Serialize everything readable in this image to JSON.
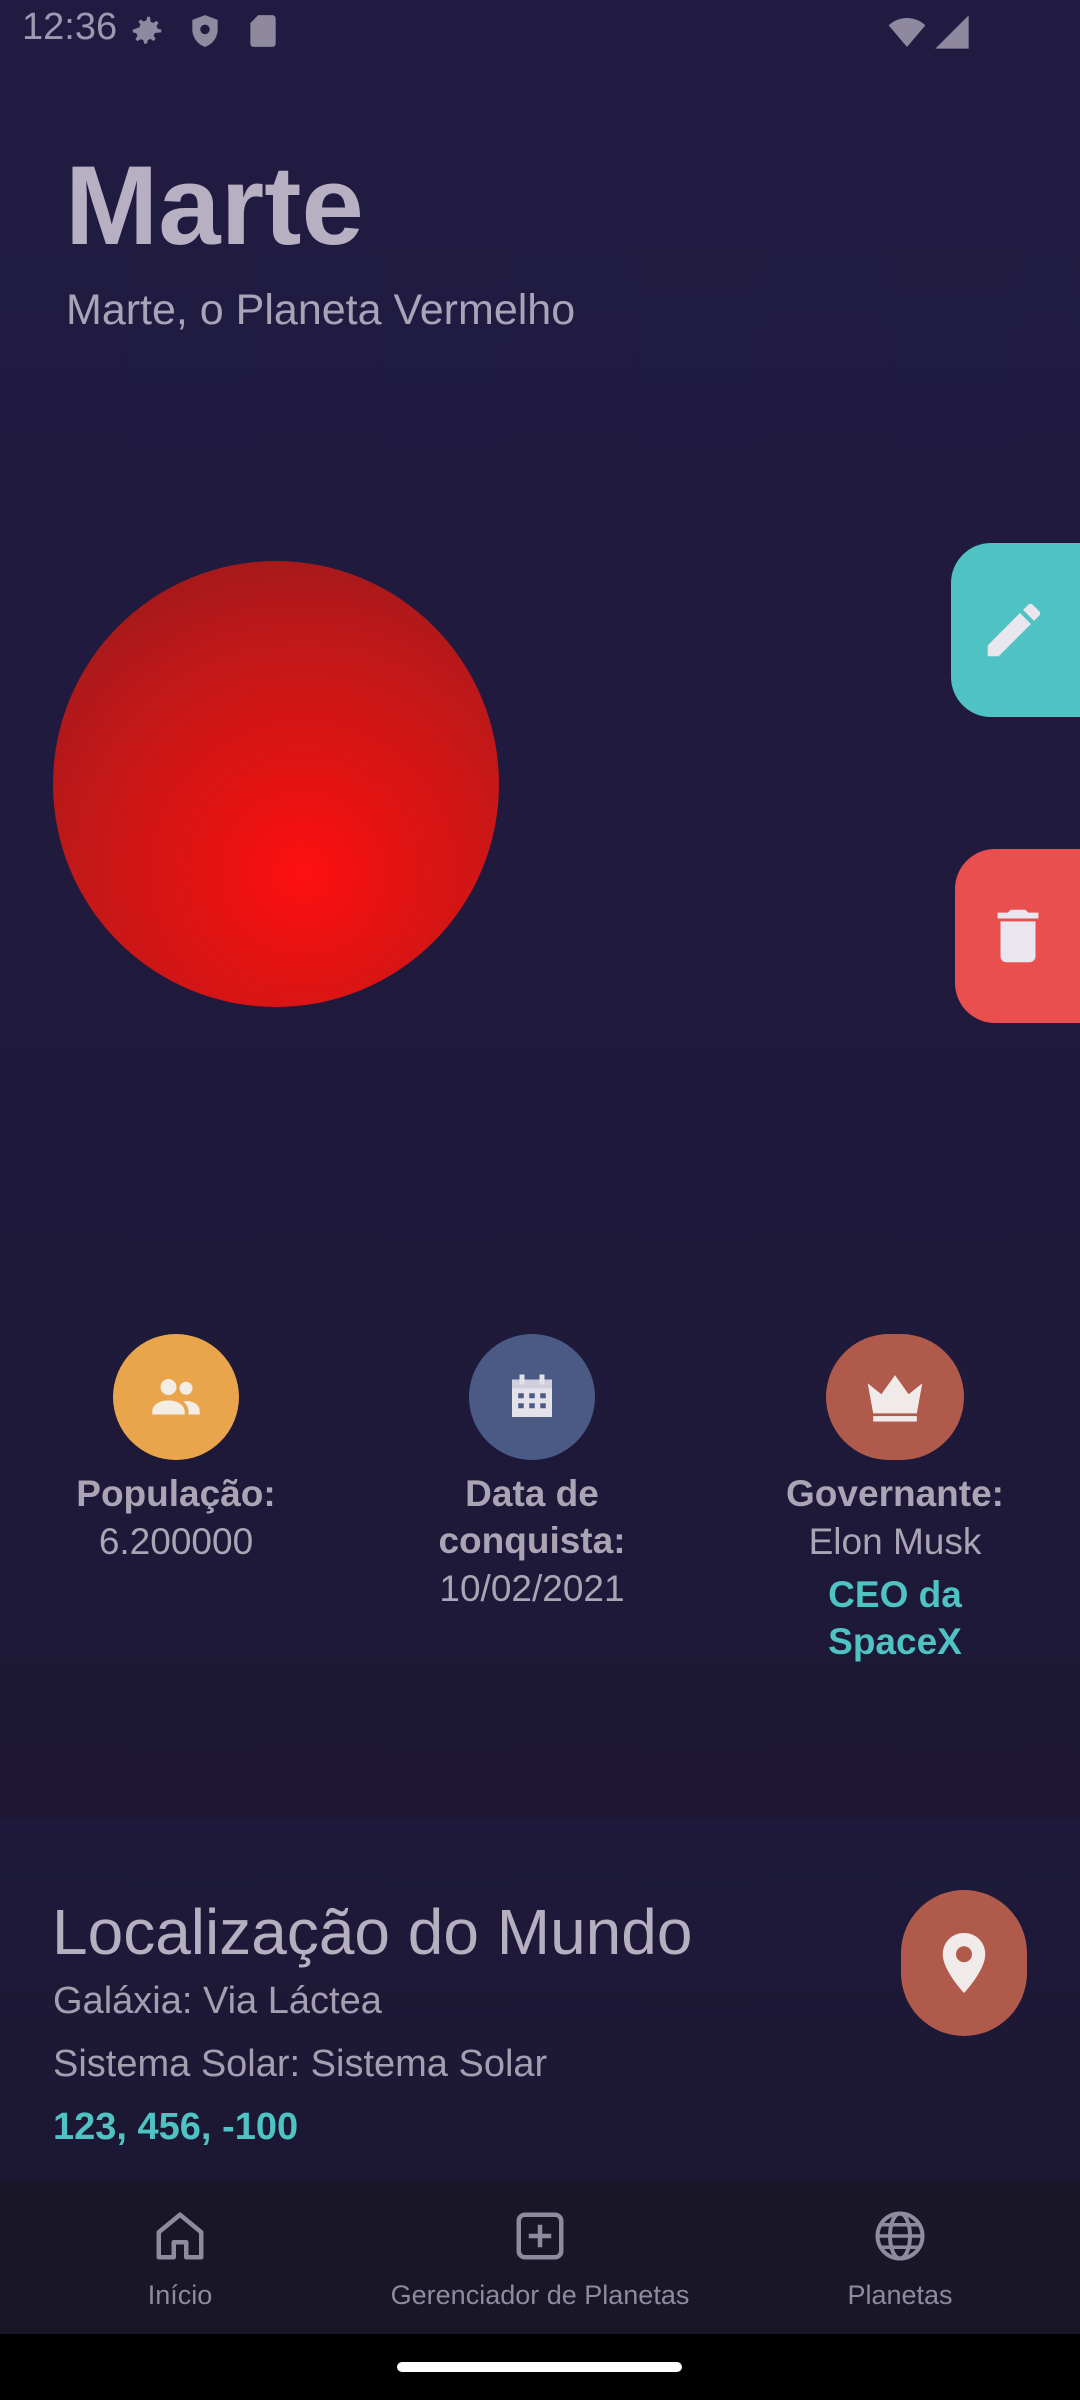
{
  "status_bar": {
    "time": "12:36",
    "left_icons": [
      "gear-icon",
      "shield-icon",
      "sd-card-icon"
    ],
    "right_icons": [
      "wifi-icon",
      "signal-icon"
    ]
  },
  "planet": {
    "name": "Marte",
    "description": "Marte, o Planeta Vermelho",
    "color": "#e51212"
  },
  "actions": {
    "edit_icon": "pencil-icon",
    "edit_color": "#4fc3c3",
    "delete_icon": "trash-icon",
    "delete_color": "#ea4f4f"
  },
  "stats": {
    "population": {
      "label": "População:",
      "value": "6.200000",
      "icon": "people-icon",
      "color": "#e8a54c"
    },
    "conquest": {
      "label_line1": "Data de",
      "label_line2": "conquista:",
      "value": "10/02/2021",
      "icon": "calendar-icon",
      "color": "#4a5a85"
    },
    "ruler": {
      "label": "Governante:",
      "value": "Elon Musk",
      "extra_line1": "CEO da",
      "extra_line2": "SpaceX",
      "icon": "crown-icon",
      "color": "#b05a4c"
    }
  },
  "location": {
    "title": "Localização do Mundo",
    "galaxy": "Galáxia: Via Láctea",
    "solar_system": "Sistema Solar: Sistema Solar",
    "coordinates": "123, 456, -100",
    "icon": "map-pin-icon"
  },
  "nav": {
    "items": [
      {
        "label": "Início",
        "icon": "home-icon"
      },
      {
        "label": "Gerenciador de Planetas",
        "icon": "add-square-icon"
      },
      {
        "label": "Planetas",
        "icon": "globe-icon"
      }
    ]
  }
}
